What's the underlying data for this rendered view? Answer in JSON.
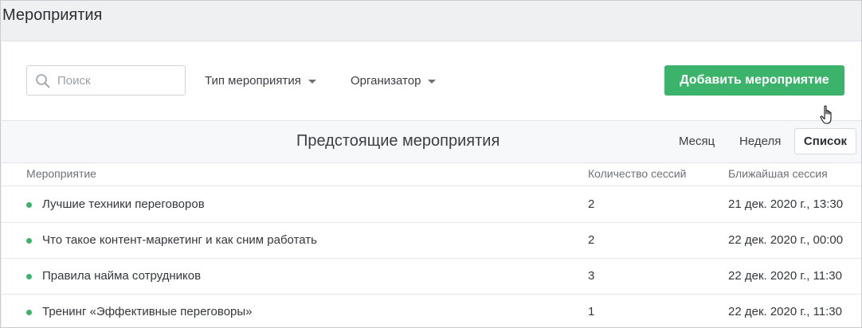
{
  "page": {
    "title": "Мероприятия"
  },
  "toolbar": {
    "search_placeholder": "Поиск",
    "search_value": "",
    "filter_type_label": "Тип мероприятия",
    "filter_organizer_label": "Организатор",
    "add_label": "Добавить мероприятие"
  },
  "view": {
    "title": "Предстоящие мероприятия",
    "tabs": [
      {
        "label": "Месяц"
      },
      {
        "label": "Неделя"
      },
      {
        "label": "Список",
        "active": true
      }
    ]
  },
  "table": {
    "columns": [
      "Мероприятие",
      "Количество сессий",
      "Ближайшая сессия"
    ],
    "rows": [
      {
        "name": "Лучшие техники переговоров",
        "sessions": "2",
        "next": "21 дек. 2020 г., 13:30"
      },
      {
        "name": "Что такое контент-маркетинг и как сним работать",
        "sessions": "2",
        "next": "22 дек. 2020 г., 00:00"
      },
      {
        "name": "Правила найма сотрудников",
        "sessions": "3",
        "next": "22 дек. 2020 г., 11:30"
      },
      {
        "name": "Тренинг «Эффективные переговоры»",
        "sessions": "1",
        "next": "22 дек. 2020 г., 11:30"
      }
    ]
  },
  "colors": {
    "accent": "#3cb36b",
    "status_dot": "#3cb36b"
  },
  "icons": {
    "search": "search-icon",
    "filter_caret": "caret-down-icon",
    "status": "status-dot-icon",
    "cursor": "hand-cursor-icon"
  }
}
